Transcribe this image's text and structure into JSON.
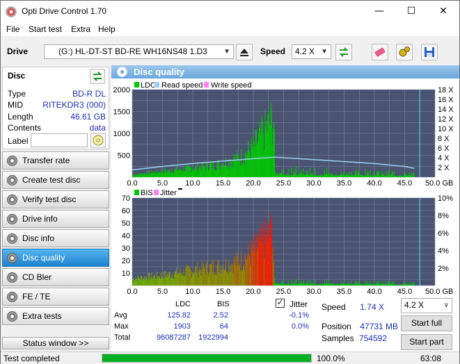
{
  "app": {
    "title": "Opti Drive Control 1.70"
  },
  "menu": {
    "file": "File",
    "start_test": "Start test",
    "extra": "Extra",
    "help": "Help"
  },
  "toolbar": {
    "drive_label": "Drive",
    "drive_value": "(G:)   HL-DT-ST BD-RE  WH16NS48 1.D3",
    "speed_label": "Speed",
    "speed_value": "4.2 X"
  },
  "disc": {
    "title": "Disc",
    "type_key": "Type",
    "type_val": "BD-R DL",
    "mid_key": "MID",
    "mid_val": "RITEKDR3 (000)",
    "length_key": "Length",
    "length_val": "46.61 GB",
    "contents_key": "Contents",
    "contents_val": "data",
    "label_key": "Label",
    "label_val": ""
  },
  "nav": {
    "items": [
      {
        "label": "Transfer rate"
      },
      {
        "label": "Create test disc"
      },
      {
        "label": "Verify test disc"
      },
      {
        "label": "Drive info"
      },
      {
        "label": "Disc info"
      },
      {
        "label": "Disc quality"
      },
      {
        "label": "CD Bler"
      },
      {
        "label": "FE / TE"
      },
      {
        "label": "Extra tests"
      }
    ],
    "status_window": "Status window >>"
  },
  "panel": {
    "title": "Disc quality"
  },
  "legend1": {
    "ldc": "LDC",
    "read": "Read speed",
    "write": "Write speed"
  },
  "legend2": {
    "bis": "BIS",
    "jitter": "Jitter"
  },
  "chart_data": [
    {
      "type": "bar",
      "title": "",
      "x_unit": "GB",
      "xlim": [
        0,
        50
      ],
      "ylim": [
        0,
        2000
      ],
      "y2lim": [
        0,
        18
      ],
      "x_ticks": [
        "0.0",
        "5.0",
        "10.0",
        "15.0",
        "20.0",
        "25.0",
        "30.0",
        "35.0",
        "40.0",
        "45.0",
        "50.0 GB"
      ],
      "y_ticks": [
        "2000",
        "1500",
        "1000",
        "500"
      ],
      "y2_ticks": [
        "18 X",
        "16 X",
        "14 X",
        "12 X",
        "10 X",
        "8 X",
        "6 X",
        "4 X",
        "2 X"
      ],
      "series": [
        {
          "name": "LDC",
          "color": "#00c800"
        },
        {
          "name": "Read speed",
          "color": "#9ad0f0"
        },
        {
          "name": "Write speed",
          "color": "#ff80ff"
        }
      ],
      "ldc_envelope": [
        [
          0,
          80
        ],
        [
          4,
          180
        ],
        [
          8,
          260
        ],
        [
          12,
          360
        ],
        [
          15,
          480
        ],
        [
          18,
          700
        ],
        [
          20,
          1000
        ],
        [
          21,
          1300
        ],
        [
          22,
          1600
        ],
        [
          23,
          1900
        ],
        [
          23.4,
          1903
        ],
        [
          23.6,
          300
        ],
        [
          30,
          220
        ],
        [
          40,
          180
        ],
        [
          46.6,
          120
        ]
      ],
      "read_speed": [
        [
          0,
          1.5
        ],
        [
          5,
          2.2
        ],
        [
          10,
          2.8
        ],
        [
          15,
          3.3
        ],
        [
          20,
          3.8
        ],
        [
          23.5,
          4.1
        ],
        [
          30,
          3.6
        ],
        [
          35,
          3.2
        ],
        [
          40,
          2.8
        ],
        [
          45,
          2.2
        ],
        [
          46.6,
          1.8
        ]
      ]
    },
    {
      "type": "bar",
      "title": "",
      "x_unit": "GB",
      "xlim": [
        0,
        50
      ],
      "ylim": [
        0,
        70
      ],
      "y2lim": [
        0,
        10
      ],
      "x_ticks": [
        "0.0",
        "5.0",
        "10.0",
        "15.0",
        "20.0",
        "25.0",
        "30.0",
        "35.0",
        "40.0",
        "45.0",
        "50.0 GB"
      ],
      "y_ticks": [
        "70",
        "60",
        "50",
        "40",
        "30",
        "20",
        "10"
      ],
      "y2_ticks": [
        "10%",
        "8%",
        "6%",
        "4%",
        "2%"
      ],
      "series": [
        {
          "name": "BIS",
          "color": "#00c800"
        },
        {
          "name": "Jitter",
          "color": "#ff80ff"
        }
      ],
      "bis_envelope": [
        [
          0,
          8
        ],
        [
          5,
          12
        ],
        [
          10,
          18
        ],
        [
          15,
          24
        ],
        [
          18,
          30
        ],
        [
          20,
          40
        ],
        [
          22,
          55
        ],
        [
          23.2,
          64
        ],
        [
          23.5,
          6
        ],
        [
          30,
          5
        ],
        [
          40,
          4
        ],
        [
          46.6,
          3
        ]
      ]
    }
  ],
  "stats": {
    "col_ldc": "LDC",
    "col_bis": "BIS",
    "row_avg": "Avg",
    "row_max": "Max",
    "row_total": "Total",
    "avg_ldc": "125.82",
    "avg_bis": "2.52",
    "max_ldc": "1903",
    "max_bis": "64",
    "total_ldc": "96087287",
    "total_bis": "1922994",
    "jitter_label": "Jitter",
    "jitter_avg": "-0.1%",
    "jitter_max": "0.0%",
    "speed_label": "Speed",
    "speed_val": "1.74 X",
    "speed_select": "4.2 X",
    "position_label": "Position",
    "position_val": "47731 MB",
    "samples_label": "Samples",
    "samples_val": "754592",
    "start_full": "Start full",
    "start_part": "Start part"
  },
  "status": {
    "text": "Test completed",
    "progress_pct": 100,
    "progress_text": "100.0%",
    "time": "63:08"
  }
}
